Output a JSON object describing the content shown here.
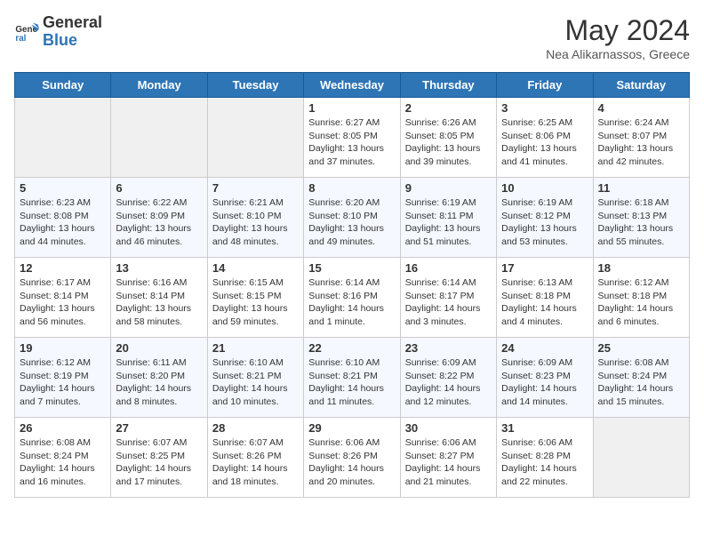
{
  "header": {
    "logo_text_general": "General",
    "logo_text_blue": "Blue",
    "month_title": "May 2024",
    "subtitle": "Nea Alikarnassos, Greece"
  },
  "days_of_week": [
    "Sunday",
    "Monday",
    "Tuesday",
    "Wednesday",
    "Thursday",
    "Friday",
    "Saturday"
  ],
  "weeks": [
    [
      {
        "day": "",
        "info": ""
      },
      {
        "day": "",
        "info": ""
      },
      {
        "day": "",
        "info": ""
      },
      {
        "day": "1",
        "info": "Sunrise: 6:27 AM\nSunset: 8:05 PM\nDaylight: 13 hours\nand 37 minutes."
      },
      {
        "day": "2",
        "info": "Sunrise: 6:26 AM\nSunset: 8:05 PM\nDaylight: 13 hours\nand 39 minutes."
      },
      {
        "day": "3",
        "info": "Sunrise: 6:25 AM\nSunset: 8:06 PM\nDaylight: 13 hours\nand 41 minutes."
      },
      {
        "day": "4",
        "info": "Sunrise: 6:24 AM\nSunset: 8:07 PM\nDaylight: 13 hours\nand 42 minutes."
      }
    ],
    [
      {
        "day": "5",
        "info": "Sunrise: 6:23 AM\nSunset: 8:08 PM\nDaylight: 13 hours\nand 44 minutes."
      },
      {
        "day": "6",
        "info": "Sunrise: 6:22 AM\nSunset: 8:09 PM\nDaylight: 13 hours\nand 46 minutes."
      },
      {
        "day": "7",
        "info": "Sunrise: 6:21 AM\nSunset: 8:10 PM\nDaylight: 13 hours\nand 48 minutes."
      },
      {
        "day": "8",
        "info": "Sunrise: 6:20 AM\nSunset: 8:10 PM\nDaylight: 13 hours\nand 49 minutes."
      },
      {
        "day": "9",
        "info": "Sunrise: 6:19 AM\nSunset: 8:11 PM\nDaylight: 13 hours\nand 51 minutes."
      },
      {
        "day": "10",
        "info": "Sunrise: 6:19 AM\nSunset: 8:12 PM\nDaylight: 13 hours\nand 53 minutes."
      },
      {
        "day": "11",
        "info": "Sunrise: 6:18 AM\nSunset: 8:13 PM\nDaylight: 13 hours\nand 55 minutes."
      }
    ],
    [
      {
        "day": "12",
        "info": "Sunrise: 6:17 AM\nSunset: 8:14 PM\nDaylight: 13 hours\nand 56 minutes."
      },
      {
        "day": "13",
        "info": "Sunrise: 6:16 AM\nSunset: 8:14 PM\nDaylight: 13 hours\nand 58 minutes."
      },
      {
        "day": "14",
        "info": "Sunrise: 6:15 AM\nSunset: 8:15 PM\nDaylight: 13 hours\nand 59 minutes."
      },
      {
        "day": "15",
        "info": "Sunrise: 6:14 AM\nSunset: 8:16 PM\nDaylight: 14 hours\nand 1 minute."
      },
      {
        "day": "16",
        "info": "Sunrise: 6:14 AM\nSunset: 8:17 PM\nDaylight: 14 hours\nand 3 minutes."
      },
      {
        "day": "17",
        "info": "Sunrise: 6:13 AM\nSunset: 8:18 PM\nDaylight: 14 hours\nand 4 minutes."
      },
      {
        "day": "18",
        "info": "Sunrise: 6:12 AM\nSunset: 8:18 PM\nDaylight: 14 hours\nand 6 minutes."
      }
    ],
    [
      {
        "day": "19",
        "info": "Sunrise: 6:12 AM\nSunset: 8:19 PM\nDaylight: 14 hours\nand 7 minutes."
      },
      {
        "day": "20",
        "info": "Sunrise: 6:11 AM\nSunset: 8:20 PM\nDaylight: 14 hours\nand 8 minutes."
      },
      {
        "day": "21",
        "info": "Sunrise: 6:10 AM\nSunset: 8:21 PM\nDaylight: 14 hours\nand 10 minutes."
      },
      {
        "day": "22",
        "info": "Sunrise: 6:10 AM\nSunset: 8:21 PM\nDaylight: 14 hours\nand 11 minutes."
      },
      {
        "day": "23",
        "info": "Sunrise: 6:09 AM\nSunset: 8:22 PM\nDaylight: 14 hours\nand 12 minutes."
      },
      {
        "day": "24",
        "info": "Sunrise: 6:09 AM\nSunset: 8:23 PM\nDaylight: 14 hours\nand 14 minutes."
      },
      {
        "day": "25",
        "info": "Sunrise: 6:08 AM\nSunset: 8:24 PM\nDaylight: 14 hours\nand 15 minutes."
      }
    ],
    [
      {
        "day": "26",
        "info": "Sunrise: 6:08 AM\nSunset: 8:24 PM\nDaylight: 14 hours\nand 16 minutes."
      },
      {
        "day": "27",
        "info": "Sunrise: 6:07 AM\nSunset: 8:25 PM\nDaylight: 14 hours\nand 17 minutes."
      },
      {
        "day": "28",
        "info": "Sunrise: 6:07 AM\nSunset: 8:26 PM\nDaylight: 14 hours\nand 18 minutes."
      },
      {
        "day": "29",
        "info": "Sunrise: 6:06 AM\nSunset: 8:26 PM\nDaylight: 14 hours\nand 20 minutes."
      },
      {
        "day": "30",
        "info": "Sunrise: 6:06 AM\nSunset: 8:27 PM\nDaylight: 14 hours\nand 21 minutes."
      },
      {
        "day": "31",
        "info": "Sunrise: 6:06 AM\nSunset: 8:28 PM\nDaylight: 14 hours\nand 22 minutes."
      },
      {
        "day": "",
        "info": ""
      }
    ]
  ]
}
